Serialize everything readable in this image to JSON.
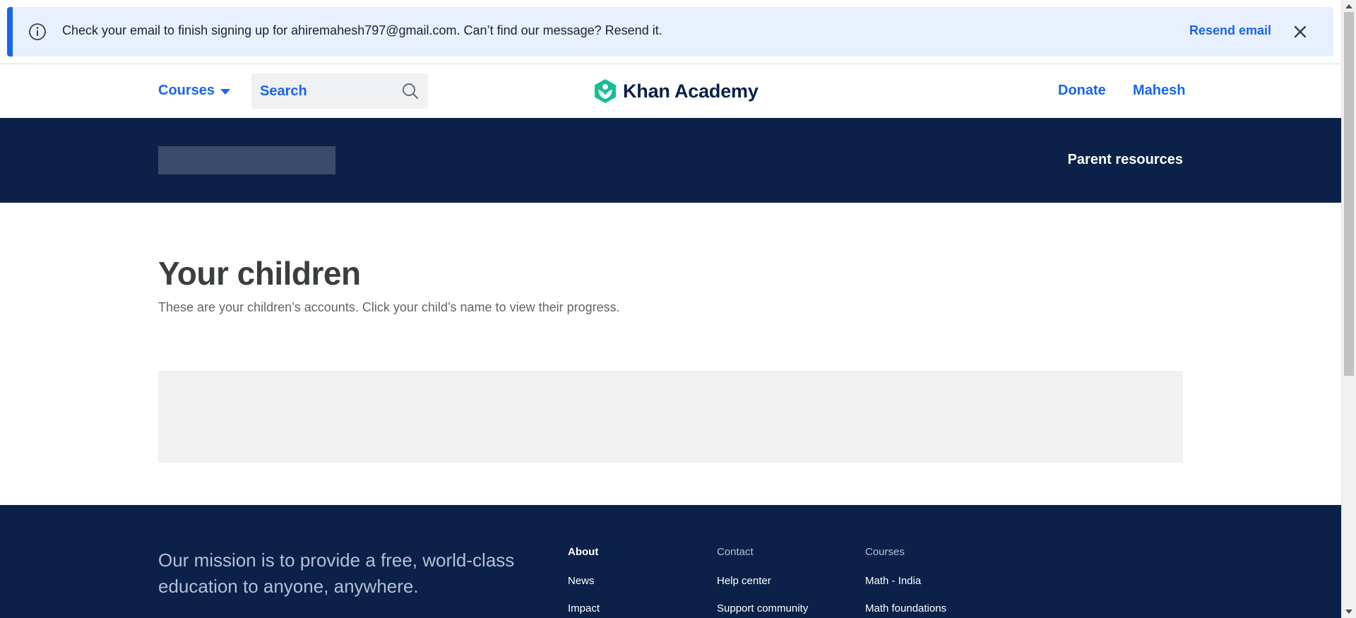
{
  "banner": {
    "message": "Check your email to finish signing up for ahiremahesh797@gmail.com. Can’t find our message? Resend it.",
    "resend_label": "Resend email",
    "info_icon": "info-circle-icon",
    "close_icon": "close-icon"
  },
  "header": {
    "courses_label": "Courses",
    "search_label": "Search",
    "logo_text": "Khan Academy",
    "donate_label": "Donate",
    "user_label": "Mahesh"
  },
  "band": {
    "parent_resources_label": "Parent resources"
  },
  "main": {
    "title": "Your children",
    "subtitle": "These are your children’s accounts. Click your child’s name to view their progress."
  },
  "footer": {
    "mission": "Our mission is to provide a free, world-class education to anyone, anywhere.",
    "columns": [
      {
        "heading": "About",
        "links": [
          "News",
          "Impact"
        ]
      },
      {
        "heading": "Contact",
        "links": [
          "Help center",
          "Support community"
        ]
      },
      {
        "heading": "Courses",
        "links": [
          "Math - India",
          "Math foundations"
        ]
      }
    ]
  },
  "colors": {
    "accent_blue": "#1865f2",
    "navy": "#0b2149",
    "banner_bg": "#e8f0fd",
    "logo_green": "#14bf96"
  }
}
